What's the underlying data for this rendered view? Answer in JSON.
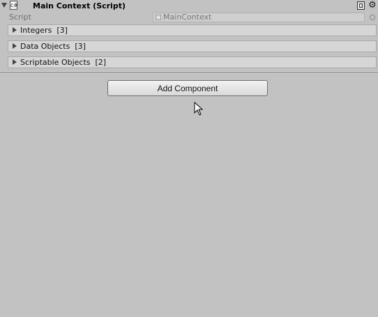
{
  "component": {
    "title": "Main Context (Script)",
    "icons": [
      "foldout-arrow",
      "script-icon",
      "help-icon",
      "gear-icon"
    ]
  },
  "script_field": {
    "label": "Script",
    "value": "MainContext"
  },
  "foldouts": [
    {
      "label": "Integers",
      "count": "[3]"
    },
    {
      "label": "Data Objects",
      "count": "[3]"
    },
    {
      "label": "Scriptable Objects",
      "count": "[2]"
    }
  ],
  "add_component_label": "Add Component",
  "colors": {
    "background": "#c2c2c2",
    "row_background": "#d6d6d6",
    "button_background": "#e6e6e6"
  }
}
